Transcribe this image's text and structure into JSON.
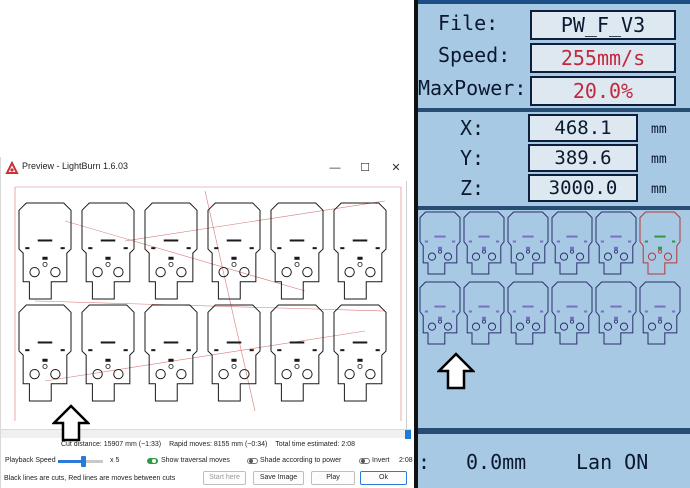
{
  "lightburn": {
    "window_title": "Preview - LightBurn 1.6.03",
    "minimize_symbol": "—",
    "maximize_symbol": "☐",
    "close_symbol": "✕",
    "stats": {
      "cut_distance": "Cut distance: 15907 mm (~1:33)",
      "rapid_moves": "Rapid moves: 8155 mm (~0:34)",
      "total_time": "Total time estimated: 2:08"
    },
    "playback_speed_label": "Playback Speed",
    "playback_speed_value": "x 5",
    "show_traversal_label": "Show traversal moves",
    "shade_label": "Shade according to power",
    "invert_label": "Invert",
    "time_value": "2:08",
    "legend_text": "Black lines are cuts, Red lines are moves between cuts",
    "buttons": {
      "start_here": "Start here",
      "save_image": "Save Image",
      "play": "Play",
      "ok": "Ok"
    },
    "playback_progress": 0.99,
    "playback_speed_fraction": 0.55,
    "toggles": {
      "show_traversal": true,
      "shade": false,
      "invert": false
    }
  },
  "machine_display": {
    "file_label": "File:",
    "file_value": "PW_F_V3",
    "speed_label": "Speed:",
    "speed_value": "255mm/s",
    "maxpower_label": "MaxPower:",
    "maxpower_value": "20.0%",
    "x_label": "X:",
    "x_value": "468.1",
    "y_label": "Y:",
    "y_value": "389.6",
    "z_label": "Z:",
    "z_value": "3000.0",
    "unit": "mm",
    "status_prefix": ":",
    "status_value": "0.0mm",
    "network_status": "Lan ON"
  },
  "colors": {
    "lightburn_accent": "#1e7bd8",
    "cut_line": "#1a1a1a",
    "move_line": "#d77a7a",
    "lcd_background": "#a8c9e3",
    "lcd_dark": "#1c4f86",
    "lcd_highlight": "#c2293d"
  }
}
